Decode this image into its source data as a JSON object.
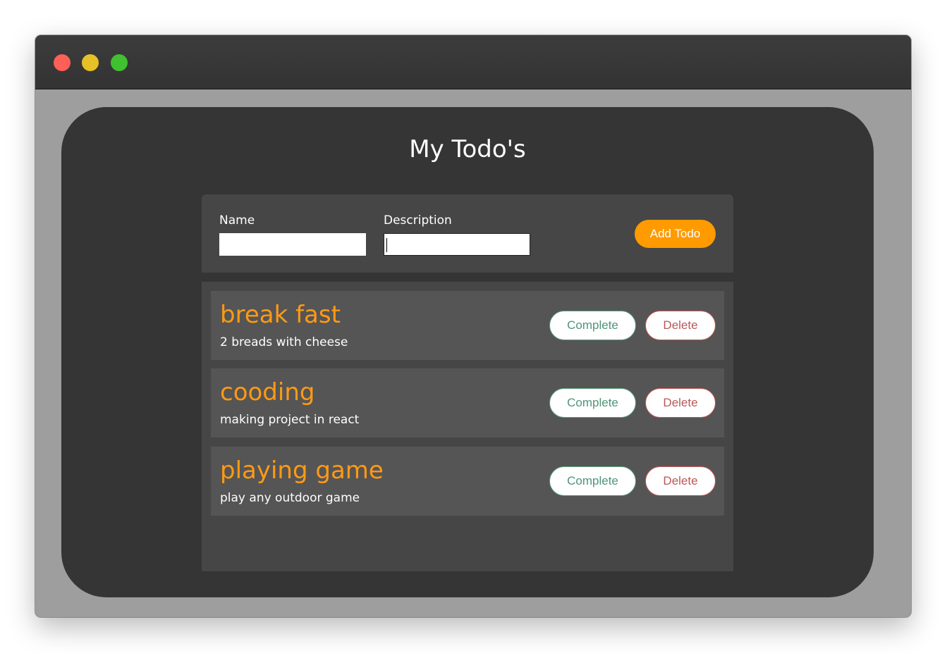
{
  "app": {
    "title": "My Todo's"
  },
  "form": {
    "name_label": "Name",
    "name_value": "",
    "description_label": "Description",
    "description_value": "",
    "add_button_label": "Add Todo"
  },
  "todos": [
    {
      "title": "break fast",
      "description": "2 breads with cheese",
      "complete_label": "Complete",
      "delete_label": "Delete"
    },
    {
      "title": "cooding",
      "description": "making project in react",
      "complete_label": "Complete",
      "delete_label": "Delete"
    },
    {
      "title": "playing game",
      "description": "play any outdoor game",
      "complete_label": "Complete",
      "delete_label": "Delete"
    }
  ],
  "colors": {
    "accent": "#ff9a00",
    "complete": "#4f9478",
    "delete": "#b85858",
    "background": "#353535"
  },
  "icons": {
    "close": "close-dot-icon",
    "minimize": "minimize-dot-icon",
    "zoom": "zoom-dot-icon"
  }
}
